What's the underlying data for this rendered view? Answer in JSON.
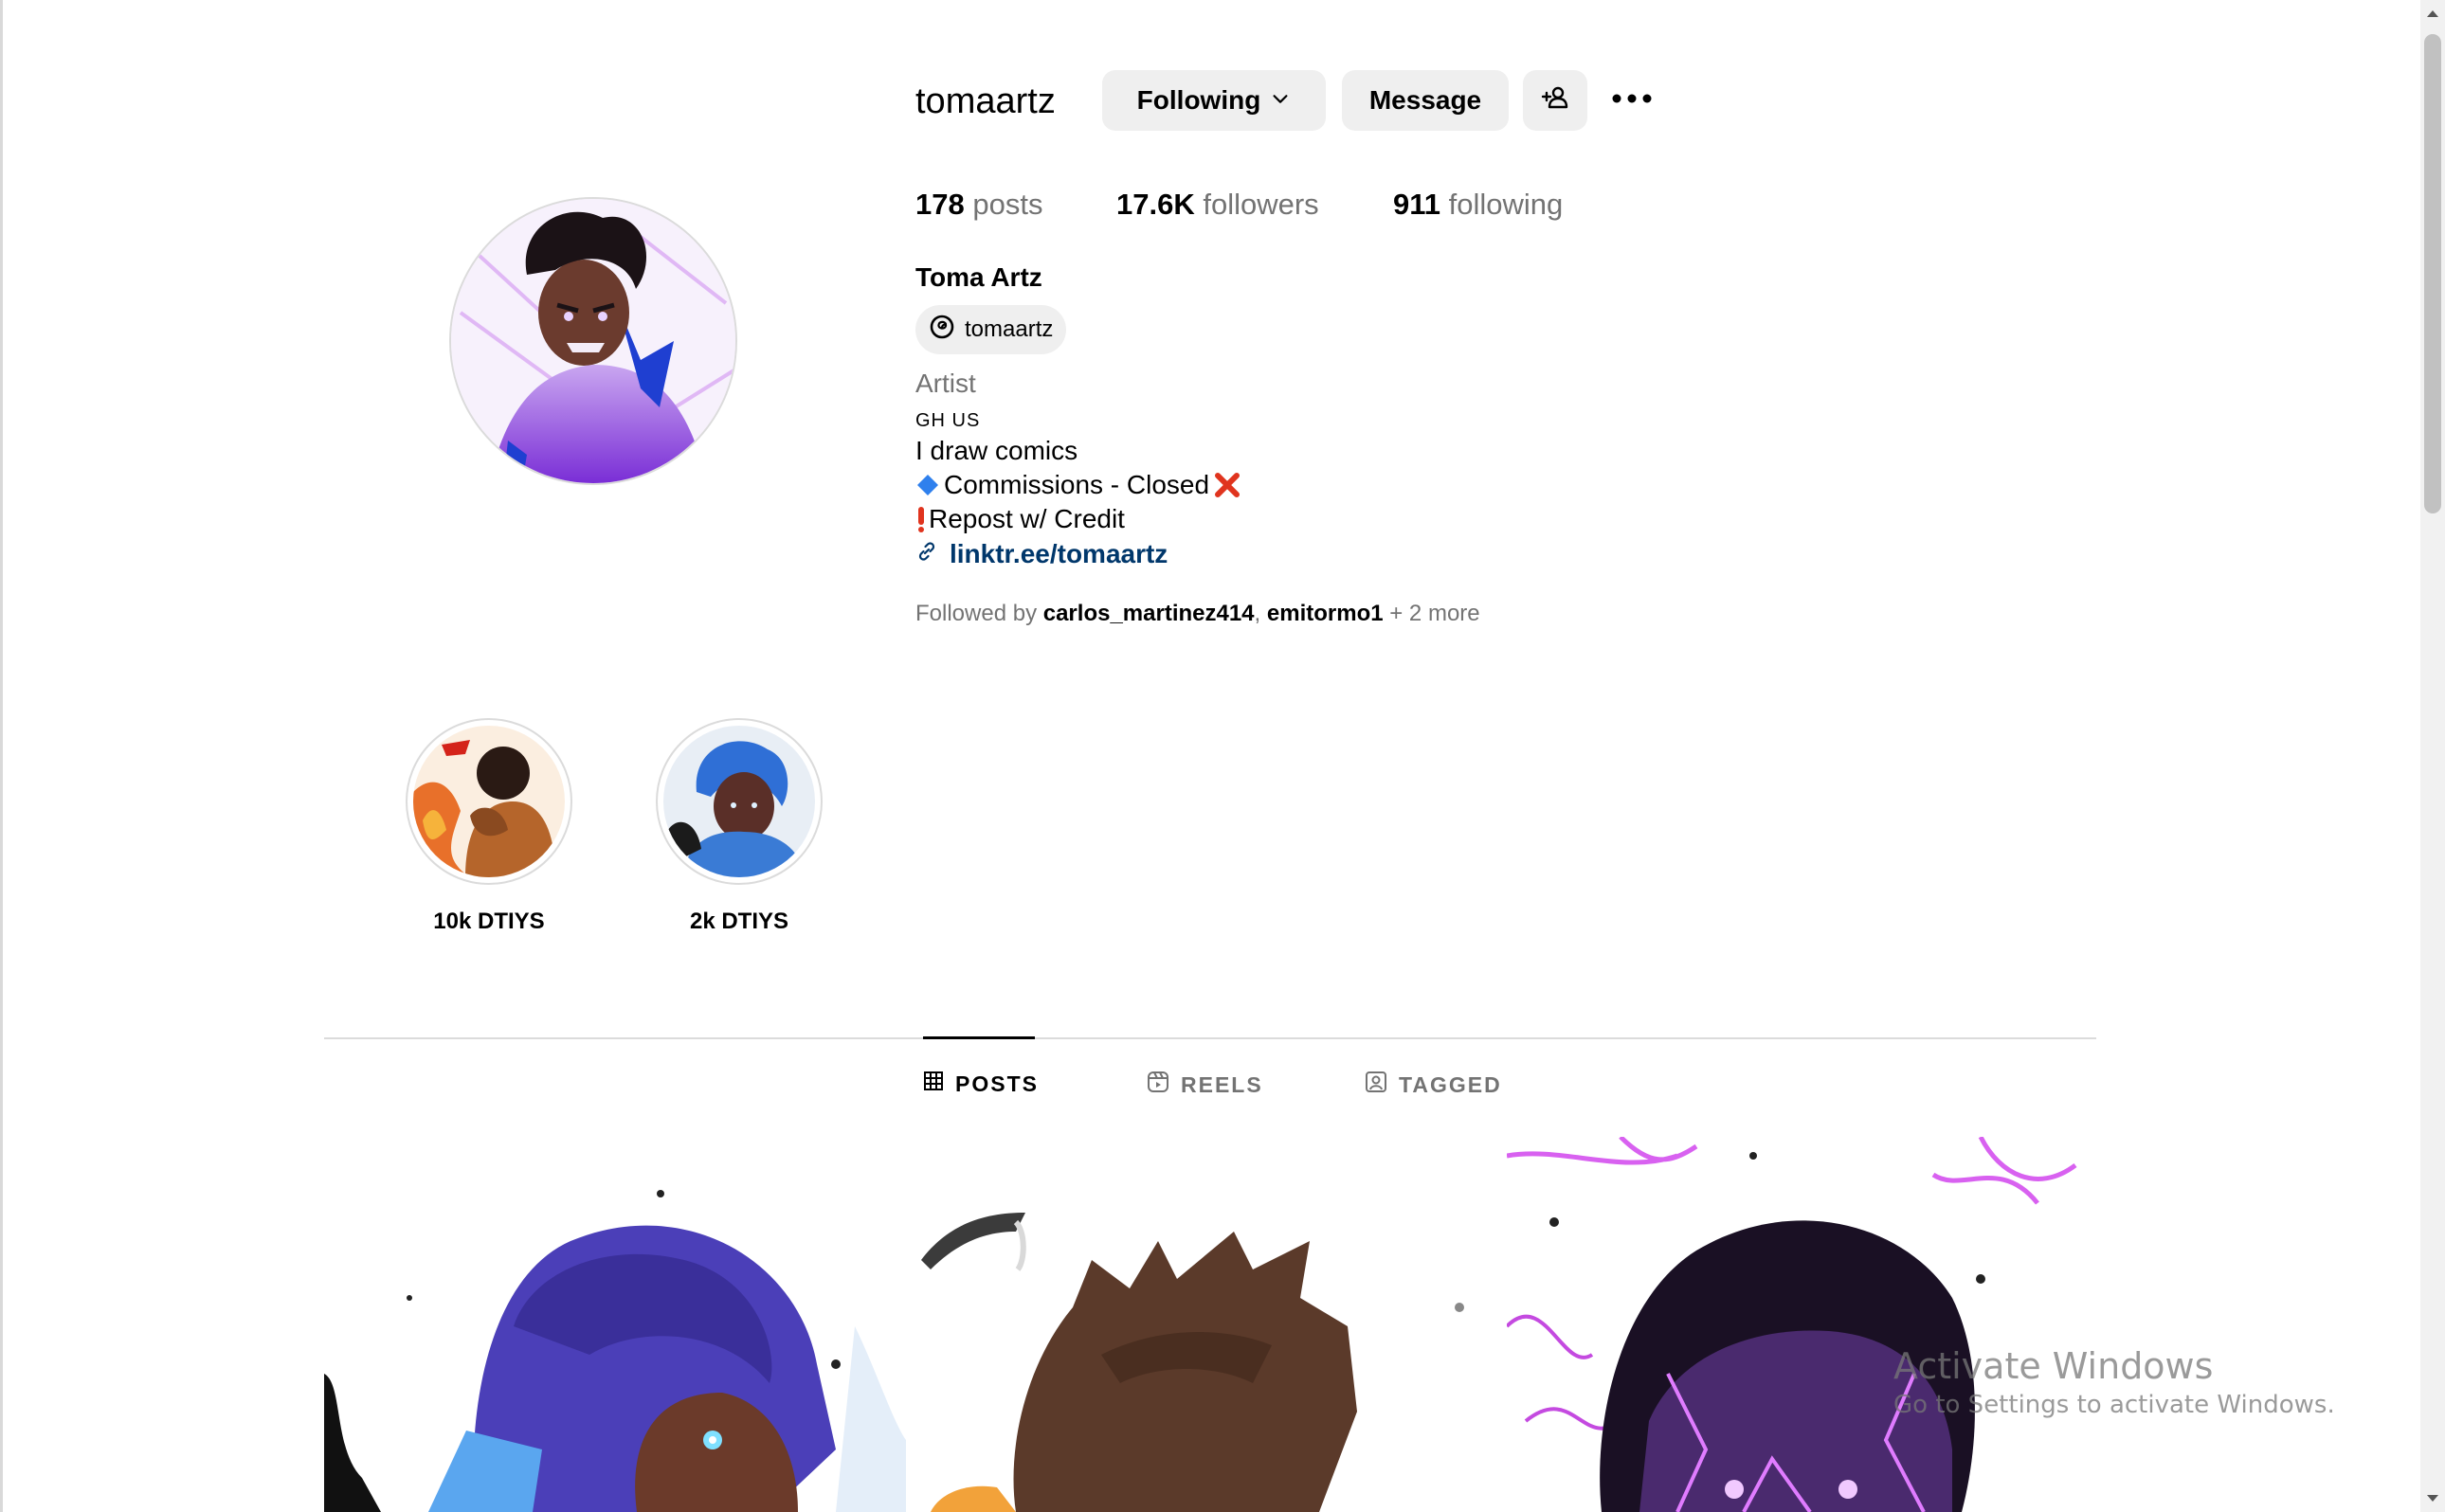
{
  "profile": {
    "username": "tomaartz",
    "following_label": "Following",
    "message_label": "Message",
    "stats": {
      "posts_count": "178",
      "posts_label": "posts",
      "followers_count": "17.6K",
      "followers_label": "followers",
      "following_count": "911",
      "following_label": "following"
    },
    "full_name": "Toma Artz",
    "threads_handle": "tomaartz",
    "category": "Artist",
    "bio": {
      "flags": "GH US",
      "line1": "I draw comics",
      "line2": "Commissions - Closed",
      "line3": "Repost w/ Credit"
    },
    "link": "linktr.ee/tomaartz",
    "followed_by": {
      "prefix": "Followed by ",
      "user1": "carlos_martinez414",
      "separator": ", ",
      "user2": "emitormo1",
      "suffix": " + 2 more"
    }
  },
  "highlights": [
    {
      "label": "10k DTIYS"
    },
    {
      "label": "2k DTIYS"
    }
  ],
  "tabs": [
    {
      "label": "POSTS"
    },
    {
      "label": "REELS"
    },
    {
      "label": "TAGGED"
    }
  ],
  "watermark": {
    "title": "Activate Windows",
    "subtitle": "Go to Settings to activate Windows."
  },
  "colors": {
    "link": "#00376b",
    "button_bg": "#efefef",
    "secondary_text": "#737373",
    "divider": "#dbdbdb"
  }
}
